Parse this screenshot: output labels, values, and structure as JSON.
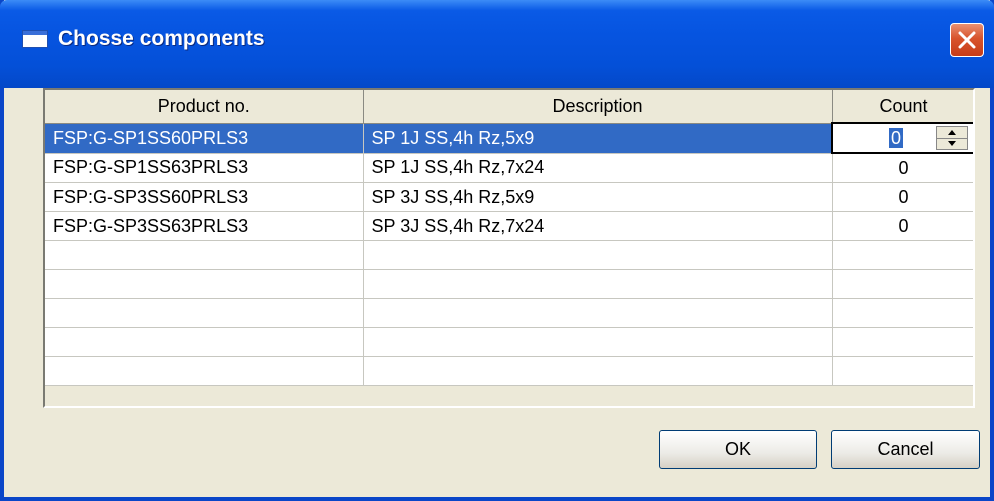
{
  "window": {
    "title": "Chosse components"
  },
  "table": {
    "columns": [
      "Product no.",
      "Description",
      "Count"
    ],
    "rows": [
      {
        "product": "FSP:G-SP1SS60PRLS3",
        "description": "SP 1J SS,4h Rz,5x9",
        "count": "0"
      },
      {
        "product": "FSP:G-SP1SS63PRLS3",
        "description": "SP 1J SS,4h Rz,7x24",
        "count": "0"
      },
      {
        "product": "FSP:G-SP3SS60PRLS3",
        "description": "SP 3J SS,4h Rz,5x9",
        "count": "0"
      },
      {
        "product": "FSP:G-SP3SS63PRLS3",
        "description": "SP 3J SS,4h Rz,7x24",
        "count": "0"
      }
    ]
  },
  "buttons": {
    "ok": "OK",
    "cancel": "Cancel"
  },
  "icons": {
    "app": "window-icon",
    "close": "close-icon",
    "spin_up": "spin-up-icon",
    "spin_down": "spin-down-icon"
  },
  "colors": {
    "titlebar": "#0450d8",
    "selection": "#316ac5",
    "close": "#d8542c",
    "face": "#ece9d8"
  }
}
